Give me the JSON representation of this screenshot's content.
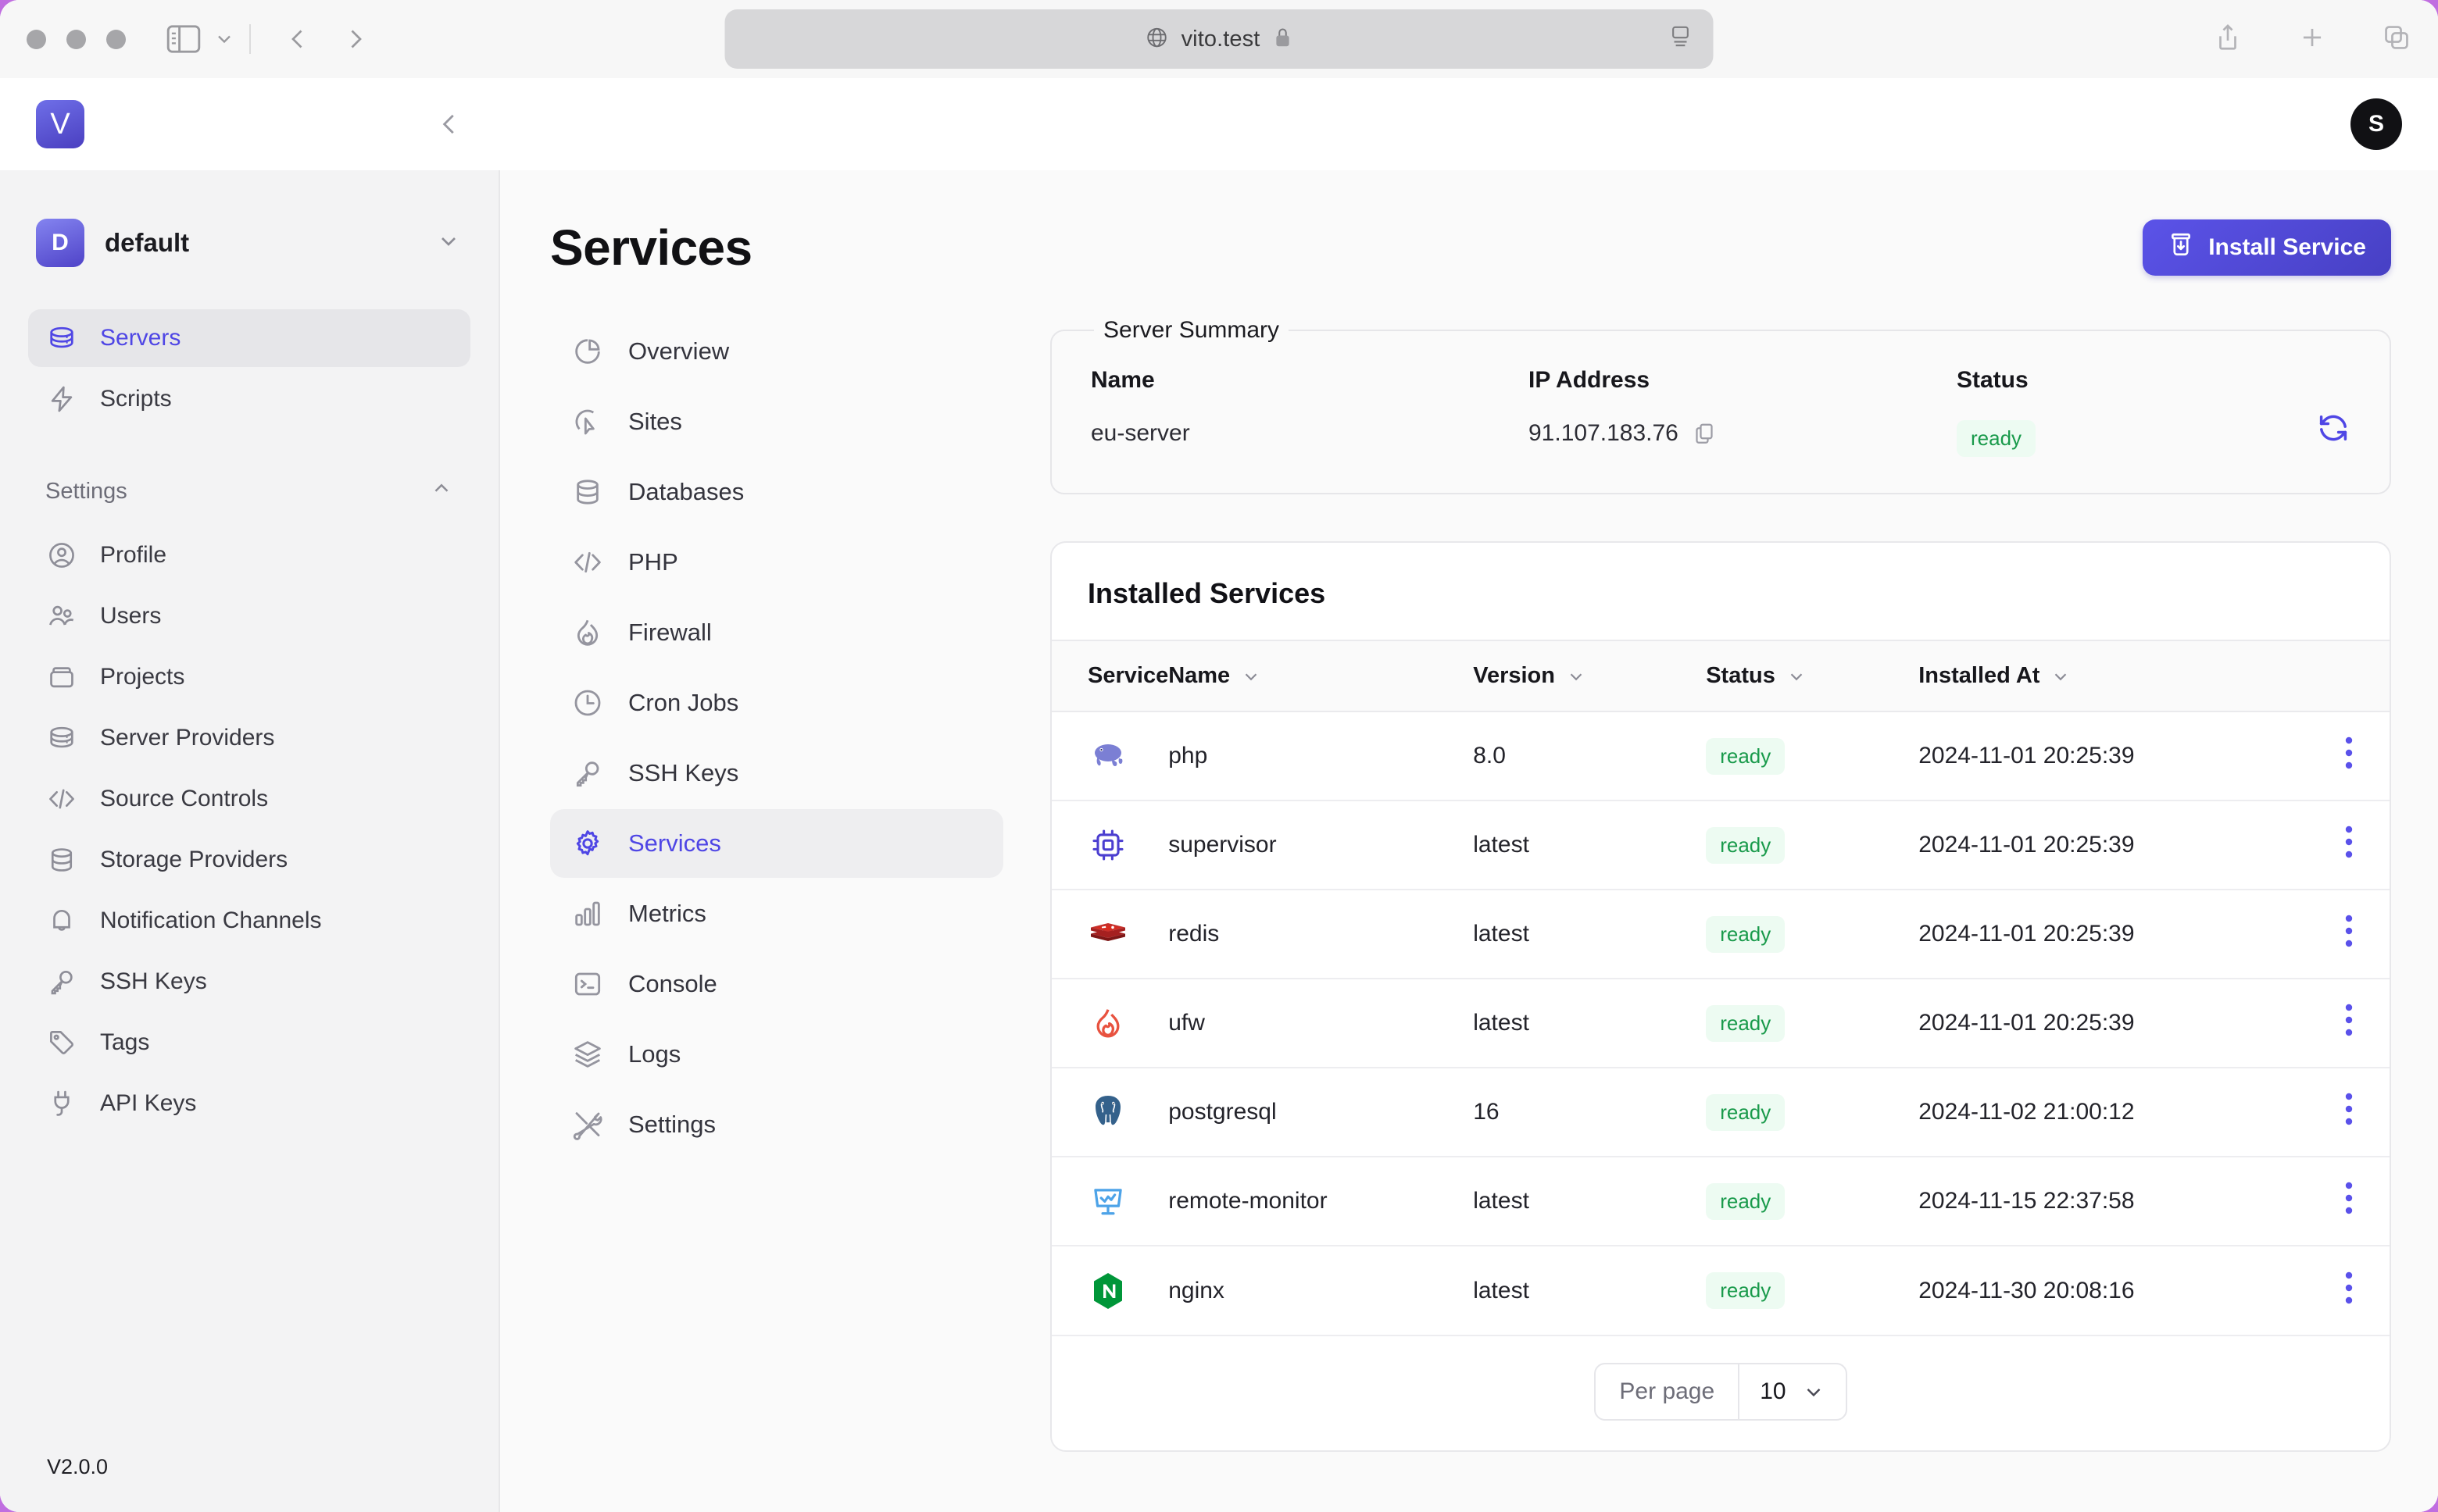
{
  "browser": {
    "url": "vito.test",
    "globe_icon": "globe-icon",
    "lock_icon": "lock-icon"
  },
  "app_header": {
    "logo_letter": "V",
    "avatar_letter": "S"
  },
  "sidebar": {
    "team": {
      "badge": "D",
      "name": "default"
    },
    "primary": [
      {
        "label": "Servers",
        "icon": "server-icon",
        "active": true
      },
      {
        "label": "Scripts",
        "icon": "lightning-icon",
        "active": false
      }
    ],
    "section_label": "Settings",
    "settings": [
      {
        "label": "Profile",
        "icon": "user-circle-icon"
      },
      {
        "label": "Users",
        "icon": "users-icon"
      },
      {
        "label": "Projects",
        "icon": "box-icon"
      },
      {
        "label": "Server Providers",
        "icon": "server-icon"
      },
      {
        "label": "Source Controls",
        "icon": "code-icon"
      },
      {
        "label": "Storage Providers",
        "icon": "database-icon"
      },
      {
        "label": "Notification Channels",
        "icon": "bell-icon"
      },
      {
        "label": "SSH Keys",
        "icon": "key-icon"
      },
      {
        "label": "Tags",
        "icon": "tag-icon"
      },
      {
        "label": "API Keys",
        "icon": "plug-icon"
      }
    ],
    "version": "V2.0.0"
  },
  "page": {
    "title": "Services",
    "install_button": "Install Service",
    "install_icon": "install-icon"
  },
  "subnav": [
    {
      "label": "Overview",
      "icon": "pie-chart-icon",
      "active": false
    },
    {
      "label": "Sites",
      "icon": "cursor-click-icon",
      "active": false
    },
    {
      "label": "Databases",
      "icon": "database-icon",
      "active": false
    },
    {
      "label": "PHP",
      "icon": "code-icon",
      "active": false
    },
    {
      "label": "Firewall",
      "icon": "flame-icon",
      "active": false
    },
    {
      "label": "Cron Jobs",
      "icon": "clock-icon",
      "active": false
    },
    {
      "label": "SSH Keys",
      "icon": "key-icon",
      "active": false
    },
    {
      "label": "Services",
      "icon": "gear-icon",
      "active": true
    },
    {
      "label": "Metrics",
      "icon": "bar-chart-icon",
      "active": false
    },
    {
      "label": "Console",
      "icon": "terminal-icon",
      "active": false
    },
    {
      "label": "Logs",
      "icon": "layers-icon",
      "active": false
    },
    {
      "label": "Settings",
      "icon": "tools-icon",
      "active": false
    }
  ],
  "server_summary": {
    "legend": "Server Summary",
    "headers": {
      "name": "Name",
      "ip": "IP Address",
      "status": "Status"
    },
    "name": "eu-server",
    "ip": "91.107.183.76",
    "copy_icon": "copy-icon",
    "status": "ready",
    "refresh_icon": "refresh-icon"
  },
  "installed_services": {
    "title": "Installed Services",
    "columns": [
      "Service",
      "Name",
      "Version",
      "Status",
      "Installed At"
    ],
    "rows": [
      {
        "icon": "php-elephant-icon",
        "name": "php",
        "version": "8.0",
        "status": "ready",
        "installed_at": "2024-11-01 20:25:39"
      },
      {
        "icon": "supervisor-chip-icon",
        "name": "supervisor",
        "version": "latest",
        "status": "ready",
        "installed_at": "2024-11-01 20:25:39"
      },
      {
        "icon": "redis-icon",
        "name": "redis",
        "version": "latest",
        "status": "ready",
        "installed_at": "2024-11-01 20:25:39"
      },
      {
        "icon": "ufw-flame-icon",
        "name": "ufw",
        "version": "latest",
        "status": "ready",
        "installed_at": "2024-11-01 20:25:39"
      },
      {
        "icon": "postgresql-elephant-icon",
        "name": "postgresql",
        "version": "16",
        "status": "ready",
        "installed_at": "2024-11-02 21:00:12"
      },
      {
        "icon": "remote-monitor-icon",
        "name": "remote-monitor",
        "version": "latest",
        "status": "ready",
        "installed_at": "2024-11-15 22:37:58"
      },
      {
        "icon": "nginx-icon",
        "name": "nginx",
        "version": "latest",
        "status": "ready",
        "installed_at": "2024-11-30 20:08:16"
      }
    ],
    "pagination": {
      "label": "Per page",
      "value": "10"
    }
  },
  "colors": {
    "accent": "#4f46e5",
    "status_ready_text": "#199a4b",
    "status_ready_bg": "#edfbf2",
    "brand_gradient_from": "#6f6fe8",
    "brand_gradient_to": "#4a3fc0"
  }
}
